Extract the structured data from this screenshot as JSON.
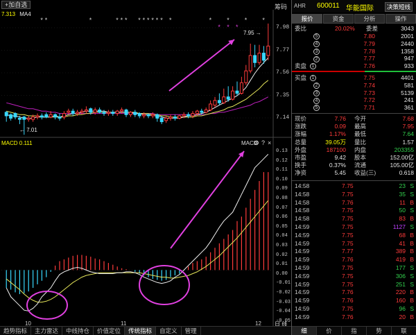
{
  "toolbar": {
    "add_label": "+加自选",
    "chip_label": "筹码"
  },
  "ma_legend": {
    "left1": "7.313",
    "left2": "MA4",
    "right": "MA"
  },
  "price_axis": [
    "7.98",
    "7.77",
    "7.56",
    "7.35",
    "7.14"
  ],
  "macd_axis": [
    "0.13",
    "0.12",
    "0.11",
    "0.10",
    "0.09",
    "0.08",
    "0.07",
    "0.06",
    "0.05",
    "0.04",
    "0.03",
    "0.02",
    "0.01",
    "0.00",
    "-0.01",
    "-0.02",
    "-0.03",
    "-0.04",
    "-0.05"
  ],
  "macd": {
    "title": "MACD 0.111",
    "label": "MACD"
  },
  "annotations": {
    "low": "7.01",
    "high": "7.95"
  },
  "x_axis": [
    "10",
    "11",
    "12"
  ],
  "bottom_tabs": [
    "趋势指标",
    "主力雷达",
    "中线持仓",
    "价值定位",
    "传统指标",
    "自定义",
    "管理"
  ],
  "right_panel": {
    "code": "600011",
    "name": "华能国际",
    "tag": "AHR",
    "menu_button": "决策短线",
    "tabs": [
      "报价",
      "资金",
      "分析",
      "操作"
    ],
    "commission": {
      "label": "委比",
      "ratio": "20.02%",
      "diff_label": "委差",
      "diff": "3043"
    },
    "sell_label": "卖盘",
    "buy_label": "买盘",
    "asks": [
      {
        "level": "5",
        "price": "7.80",
        "vol": "2001"
      },
      {
        "level": "4",
        "price": "7.79",
        "vol": "2440"
      },
      {
        "level": "3",
        "price": "7.78",
        "vol": "1358"
      },
      {
        "level": "2",
        "price": "7.77",
        "vol": "947"
      },
      {
        "level": "1",
        "price": "7.76",
        "vol": "933"
      }
    ],
    "bids": [
      {
        "level": "1",
        "price": "7.75",
        "vol": "4401"
      },
      {
        "level": "2",
        "price": "7.74",
        "vol": "581"
      },
      {
        "level": "3",
        "price": "7.73",
        "vol": "5139"
      },
      {
        "level": "4",
        "price": "7.72",
        "vol": "241"
      },
      {
        "level": "5",
        "price": "7.71",
        "vol": "361"
      }
    ],
    "stats": [
      {
        "l1": "现价",
        "v1": "7.76",
        "l2": "今开",
        "v2": "7.68",
        "c1": "red",
        "c2": "red"
      },
      {
        "l1": "涨跌",
        "v1": "0.09",
        "l2": "最高",
        "v2": "7.95",
        "c1": "red",
        "c2": "red"
      },
      {
        "l1": "涨幅",
        "v1": "1.17%",
        "l2": "最低",
        "v2": "7.64",
        "c1": "red",
        "c2": "green"
      },
      {
        "l1": "总量",
        "v1": "39.05万",
        "l2": "量比",
        "v2": "1.57",
        "c1": "yellow",
        "c2": "white"
      },
      {
        "l1": "外盘",
        "v1": "187100",
        "l2": "内盘",
        "v2": "203355",
        "c1": "red",
        "c2": "green"
      },
      {
        "l1": "市盈",
        "v1": "9.42",
        "l2": "股本",
        "v2": "152.00亿",
        "c1": "white",
        "c2": "white"
      },
      {
        "l1": "换手",
        "v1": "0.37%",
        "l2": "流通",
        "v2": "105.00亿",
        "c1": "white",
        "c2": "white"
      },
      {
        "l1": "净资",
        "v1": "5.45",
        "l2": "收益(三)",
        "v2": "0.618",
        "c1": "white",
        "c2": "white"
      }
    ],
    "ticks": [
      {
        "t": "14:58",
        "p": "7.75",
        "v": "23",
        "s": "S"
      },
      {
        "t": "14:58",
        "p": "7.75",
        "v": "35",
        "s": "S"
      },
      {
        "t": "14:58",
        "p": "7.76",
        "v": "11",
        "s": "B"
      },
      {
        "t": "14:58",
        "p": "7.75",
        "v": "50",
        "s": "S"
      },
      {
        "t": "14:58",
        "p": "7.75",
        "v": "83",
        "s": "B"
      },
      {
        "t": "14:59",
        "p": "7.75",
        "v": "1127",
        "s": "S"
      },
      {
        "t": "14:59",
        "p": "7.75",
        "v": "68",
        "s": "B"
      },
      {
        "t": "14:59",
        "p": "7.75",
        "v": "41",
        "s": "B"
      },
      {
        "t": "14:59",
        "p": "7.77",
        "v": "389",
        "s": "B"
      },
      {
        "t": "14:59",
        "p": "7.76",
        "v": "419",
        "s": "B"
      },
      {
        "t": "14:59",
        "p": "7.75",
        "v": "177",
        "s": "S"
      },
      {
        "t": "14:59",
        "p": "7.75",
        "v": "306",
        "s": "S"
      },
      {
        "t": "14:59",
        "p": "7.75",
        "v": "251",
        "s": "S"
      },
      {
        "t": "14:59",
        "p": "7.76",
        "v": "220",
        "s": "B"
      },
      {
        "t": "14:59",
        "p": "7.76",
        "v": "160",
        "s": "B"
      },
      {
        "t": "14:59",
        "p": "7.75",
        "v": "96",
        "s": "S"
      },
      {
        "t": "14:59",
        "p": "7.76",
        "v": "20",
        "s": "B"
      }
    ],
    "bottom_tabs": [
      "细",
      "价",
      "指",
      "势",
      "联"
    ]
  },
  "chart_data": {
    "type": "candlestick",
    "price_candles": [
      {
        "o": 7.2,
        "c": 7.17,
        "h": 7.21,
        "l": 7.12
      },
      {
        "o": 7.18,
        "c": 7.15,
        "h": 7.19,
        "l": 7.13
      },
      {
        "o": 7.19,
        "c": 7.16,
        "h": 7.2,
        "l": 7.14
      },
      {
        "o": 7.15,
        "c": 7.14,
        "h": 7.17,
        "l": 7.1
      },
      {
        "o": 7.16,
        "c": 7.14,
        "h": 7.17,
        "l": 7.01
      },
      {
        "o": 7.14,
        "c": 7.15,
        "h": 7.17,
        "l": 7.12
      },
      {
        "o": 7.14,
        "c": 7.16,
        "h": 7.18,
        "l": 7.12
      },
      {
        "o": 7.16,
        "c": 7.17,
        "h": 7.19,
        "l": 7.14
      },
      {
        "o": 7.17,
        "c": 7.16,
        "h": 7.19,
        "l": 7.14
      },
      {
        "o": 7.18,
        "c": 7.16,
        "h": 7.2,
        "l": 7.15
      },
      {
        "o": 7.16,
        "c": 7.18,
        "h": 7.21,
        "l": 7.15
      },
      {
        "o": 7.18,
        "c": 7.16,
        "h": 7.19,
        "l": 7.14
      },
      {
        "o": 7.16,
        "c": 7.15,
        "h": 7.19,
        "l": 7.13
      },
      {
        "o": 7.16,
        "c": 7.19,
        "h": 7.21,
        "l": 7.14
      },
      {
        "o": 7.2,
        "c": 7.21,
        "h": 7.23,
        "l": 7.18
      },
      {
        "o": 7.21,
        "c": 7.19,
        "h": 7.23,
        "l": 7.17
      },
      {
        "o": 7.19,
        "c": 7.2,
        "h": 7.22,
        "l": 7.17
      },
      {
        "o": 7.2,
        "c": 7.21,
        "h": 7.23,
        "l": 7.18
      },
      {
        "o": 7.21,
        "c": 7.22,
        "h": 7.25,
        "l": 7.19
      },
      {
        "o": 7.23,
        "c": 7.2,
        "h": 7.24,
        "l": 7.18
      },
      {
        "o": 7.2,
        "c": 7.22,
        "h": 7.24,
        "l": 7.18
      },
      {
        "o": 7.22,
        "c": 7.2,
        "h": 7.24,
        "l": 7.19
      },
      {
        "o": 7.2,
        "c": 7.19,
        "h": 7.22,
        "l": 7.17
      },
      {
        "o": 7.19,
        "c": 7.2,
        "h": 7.22,
        "l": 7.17
      },
      {
        "o": 7.2,
        "c": 7.19,
        "h": 7.22,
        "l": 7.17
      },
      {
        "o": 7.19,
        "c": 7.21,
        "h": 7.22,
        "l": 7.17
      },
      {
        "o": 7.21,
        "c": 7.22,
        "h": 7.24,
        "l": 7.19
      },
      {
        "o": 7.22,
        "c": 7.18,
        "h": 7.23,
        "l": 7.16
      },
      {
        "o": 7.18,
        "c": 7.2,
        "h": 7.21,
        "l": 7.16
      },
      {
        "o": 7.2,
        "c": 7.18,
        "h": 7.22,
        "l": 7.16
      },
      {
        "o": 7.19,
        "c": 7.17,
        "h": 7.2,
        "l": 7.15
      },
      {
        "o": 7.17,
        "c": 7.18,
        "h": 7.2,
        "l": 7.15
      },
      {
        "o": 7.18,
        "c": 7.17,
        "h": 7.19,
        "l": 7.15
      },
      {
        "o": 7.17,
        "c": 7.18,
        "h": 7.2,
        "l": 7.15
      },
      {
        "o": 7.18,
        "c": 7.15,
        "h": 7.19,
        "l": 7.12
      },
      {
        "o": 7.15,
        "c": 7.12,
        "h": 7.17,
        "l": 7.1
      },
      {
        "o": 7.13,
        "c": 7.15,
        "h": 7.17,
        "l": 7.11
      },
      {
        "o": 7.15,
        "c": 7.16,
        "h": 7.18,
        "l": 7.13
      },
      {
        "o": 7.16,
        "c": 7.15,
        "h": 7.18,
        "l": 7.13
      },
      {
        "o": 7.15,
        "c": 7.17,
        "h": 7.18,
        "l": 7.14
      },
      {
        "o": 7.17,
        "c": 7.18,
        "h": 7.2,
        "l": 7.15
      },
      {
        "o": 7.18,
        "c": 7.17,
        "h": 7.2,
        "l": 7.15
      },
      {
        "o": 7.17,
        "c": 7.19,
        "h": 7.21,
        "l": 7.15
      },
      {
        "o": 7.19,
        "c": 7.21,
        "h": 7.22,
        "l": 7.17
      },
      {
        "o": 7.21,
        "c": 7.2,
        "h": 7.23,
        "l": 7.18
      },
      {
        "o": 7.2,
        "c": 7.22,
        "h": 7.24,
        "l": 7.19
      },
      {
        "o": 7.22,
        "c": 7.27,
        "h": 7.3,
        "l": 7.21
      },
      {
        "o": 7.26,
        "c": 7.3,
        "h": 7.33,
        "l": 7.24
      },
      {
        "o": 7.3,
        "c": 7.28,
        "h": 7.36,
        "l": 7.26
      },
      {
        "o": 7.28,
        "c": 7.33,
        "h": 7.4,
        "l": 7.27
      },
      {
        "o": 7.33,
        "c": 7.31,
        "h": 7.42,
        "l": 7.29
      },
      {
        "o": 7.31,
        "c": 7.38,
        "h": 7.42,
        "l": 7.3
      },
      {
        "o": 7.38,
        "c": 7.36,
        "h": 7.46,
        "l": 7.34
      },
      {
        "o": 7.36,
        "c": 7.45,
        "h": 7.5,
        "l": 7.35
      },
      {
        "o": 7.45,
        "c": 7.55,
        "h": 7.6,
        "l": 7.43
      },
      {
        "o": 7.55,
        "c": 7.68,
        "h": 7.78,
        "l": 7.53
      },
      {
        "o": 7.68,
        "c": 7.62,
        "h": 7.77,
        "l": 7.58
      },
      {
        "o": 7.62,
        "c": 7.7,
        "h": 7.77,
        "l": 7.6
      },
      {
        "o": 7.7,
        "c": 7.64,
        "h": 7.76,
        "l": 7.61
      },
      {
        "o": 7.68,
        "c": 7.76,
        "h": 7.95,
        "l": 7.64
      }
    ],
    "ma_fast": [
      7.18,
      7.17,
      7.17,
      7.16,
      7.15,
      7.15,
      7.15,
      7.16,
      7.16,
      7.16,
      7.16,
      7.17,
      7.16,
      7.17,
      7.18,
      7.19,
      7.19,
      7.2,
      7.21,
      7.21,
      7.21,
      7.21,
      7.21,
      7.2,
      7.2,
      7.2,
      7.2,
      7.2,
      7.2,
      7.19,
      7.19,
      7.18,
      7.18,
      7.17,
      7.17,
      7.16,
      7.15,
      7.15,
      7.15,
      7.15,
      7.16,
      7.17,
      7.17,
      7.18,
      7.19,
      7.2,
      7.22,
      7.24,
      7.26,
      7.28,
      7.3,
      7.32,
      7.34,
      7.37,
      7.41,
      7.47,
      7.53,
      7.58,
      7.62,
      7.66
    ],
    "ma_mid": [
      7.21,
      7.2,
      7.19,
      7.18,
      7.18,
      7.17,
      7.17,
      7.17,
      7.16,
      7.16,
      7.16,
      7.16,
      7.16,
      7.16,
      7.17,
      7.17,
      7.18,
      7.18,
      7.19,
      7.19,
      7.2,
      7.2,
      7.2,
      7.2,
      7.2,
      7.2,
      7.2,
      7.2,
      7.2,
      7.2,
      7.19,
      7.19,
      7.19,
      7.18,
      7.18,
      7.17,
      7.17,
      7.16,
      7.16,
      7.16,
      7.16,
      7.16,
      7.16,
      7.17,
      7.17,
      7.18,
      7.19,
      7.2,
      7.21,
      7.22,
      7.24,
      7.25,
      7.27,
      7.29,
      7.31,
      7.34,
      7.37,
      7.4,
      7.44,
      7.47
    ],
    "ma_slow": [
      7.28,
      7.27,
      7.26,
      7.25,
      7.24,
      7.23,
      7.23,
      7.22,
      7.21,
      7.21,
      7.2,
      7.2,
      7.19,
      7.19,
      7.19,
      7.19,
      7.19,
      7.19,
      7.19,
      7.19,
      7.19,
      7.19,
      7.19,
      7.19,
      7.19,
      7.19,
      7.19,
      7.19,
      7.19,
      7.19,
      7.19,
      7.19,
      7.19,
      7.19,
      7.18,
      7.18,
      7.18,
      7.18,
      7.18,
      7.18,
      7.18,
      7.18,
      7.18,
      7.18,
      7.18,
      7.18,
      7.19,
      7.19,
      7.2,
      7.2,
      7.21,
      7.22,
      7.23,
      7.24,
      7.25,
      7.26,
      7.28,
      7.29,
      7.31,
      7.33
    ],
    "macd_hist": [
      -0.02,
      -0.022,
      -0.025,
      -0.027,
      -0.026,
      -0.024,
      -0.02,
      -0.016,
      -0.012,
      -0.008,
      -0.002,
      0.005,
      0.01,
      0.012,
      0.014,
      0.016,
      0.017,
      0.017,
      0.016,
      0.015,
      0.013,
      0.012,
      0.01,
      0.008,
      0.006,
      0.004,
      0.002,
      0.001,
      0.0,
      -0.002,
      -0.004,
      -0.006,
      -0.008,
      -0.01,
      -0.011,
      -0.012,
      -0.011,
      -0.008,
      -0.006,
      -0.004,
      0.0,
      0.004,
      0.008,
      0.01,
      0.012,
      0.015,
      0.02,
      0.025,
      0.03,
      0.035,
      0.04,
      0.045,
      0.055,
      0.06,
      0.07,
      0.08,
      0.09,
      0.1,
      0.11,
      0.11
    ],
    "dif": [
      -0.02,
      -0.03,
      -0.035,
      -0.04,
      -0.045,
      -0.046,
      -0.043,
      -0.038,
      -0.03,
      -0.025,
      -0.02,
      -0.012,
      -0.005,
      -0.002,
      0.0,
      0.002,
      0.003,
      0.002,
      0.0,
      -0.002,
      -0.003,
      -0.004,
      -0.004,
      -0.004,
      -0.004,
      -0.003,
      -0.003,
      -0.002,
      -0.002,
      -0.003,
      -0.005,
      -0.008,
      -0.01,
      -0.012,
      -0.014,
      -0.015,
      -0.014,
      -0.012,
      -0.008,
      -0.005,
      0.0,
      0.005,
      0.01,
      0.015,
      0.02,
      0.025,
      0.032,
      0.04,
      0.048,
      0.055,
      0.06,
      0.065,
      0.075,
      0.085,
      0.095,
      0.105,
      0.115,
      0.12,
      0.125,
      0.13
    ],
    "dea": [
      -0.01,
      -0.014,
      -0.018,
      -0.022,
      -0.027,
      -0.031,
      -0.034,
      -0.036,
      -0.036,
      -0.035,
      -0.033,
      -0.03,
      -0.026,
      -0.022,
      -0.018,
      -0.014,
      -0.011,
      -0.008,
      -0.006,
      -0.005,
      -0.004,
      -0.003,
      -0.003,
      -0.003,
      -0.003,
      -0.003,
      -0.003,
      -0.003,
      -0.003,
      -0.003,
      -0.003,
      -0.004,
      -0.005,
      -0.006,
      -0.007,
      -0.008,
      -0.008,
      -0.009,
      -0.009,
      -0.008,
      -0.007,
      -0.006,
      -0.004,
      -0.002,
      0.001,
      0.004,
      0.008,
      0.012,
      0.016,
      0.021,
      0.026,
      0.031,
      0.036,
      0.042,
      0.048,
      0.054,
      0.06,
      0.066,
      0.072,
      0.078
    ],
    "price_range": [
      7.0,
      8.02
    ],
    "macd_range": [
      -0.055,
      0.135
    ]
  }
}
